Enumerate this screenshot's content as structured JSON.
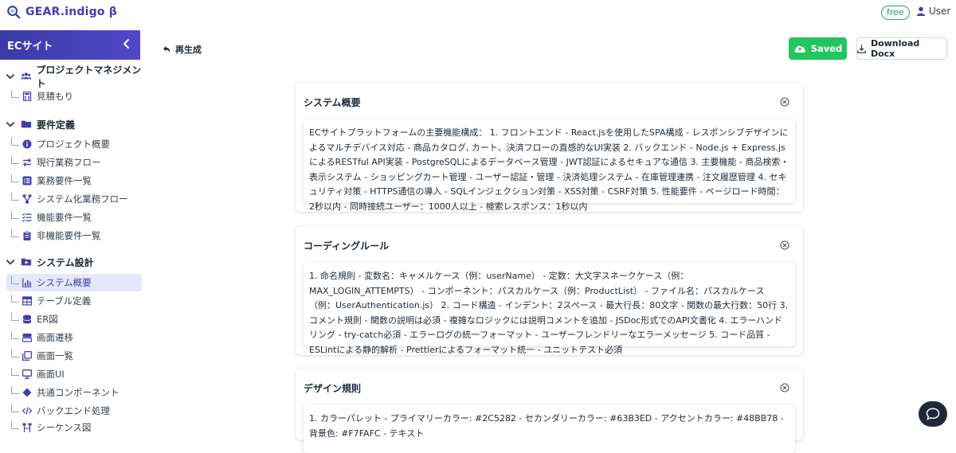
{
  "app": {
    "brand": "GEAR.indigo β",
    "plan_badge": "free",
    "user_label": "User"
  },
  "sidebar": {
    "project_name": "ECサイト",
    "sections": [
      {
        "label": "プロジェクトマネジメント",
        "icon": "users-icon",
        "items": [
          {
            "label": "見積もり",
            "icon": "calculator-icon"
          }
        ]
      },
      {
        "label": "要件定義",
        "icon": "folder-icon",
        "items": [
          {
            "label": "プロジェクト概要",
            "icon": "info-icon"
          },
          {
            "label": "現行業務フロー",
            "icon": "swap-icon"
          },
          {
            "label": "業務要件一覧",
            "icon": "list-icon"
          },
          {
            "label": "システム化業務フロー",
            "icon": "flow-icon"
          },
          {
            "label": "機能要件一覧",
            "icon": "checklist-icon"
          },
          {
            "label": "非機能要件一覧",
            "icon": "clipboard-icon"
          }
        ]
      },
      {
        "label": "システム設計",
        "icon": "folder-plus-icon",
        "items": [
          {
            "label": "システム概要",
            "icon": "bar-chart-icon",
            "active": true
          },
          {
            "label": "テーブル定義",
            "icon": "table-icon"
          },
          {
            "label": "ER図",
            "icon": "database-icon"
          },
          {
            "label": "画面遷移",
            "icon": "screens-icon"
          },
          {
            "label": "画面一覧",
            "icon": "copy-icon"
          },
          {
            "label": "画面UI",
            "icon": "monitor-icon"
          },
          {
            "label": "共通コンポーネント",
            "icon": "diamond-icon"
          },
          {
            "label": "バックエンド処理",
            "icon": "code-icon"
          },
          {
            "label": "シーケンス図",
            "icon": "sequence-icon"
          }
        ]
      }
    ]
  },
  "toolbar": {
    "regenerate_label": "再生成",
    "saved_label": "Saved",
    "download_label": "Download Docx"
  },
  "cards": [
    {
      "title": "システム概要",
      "body": "ECサイトプラットフォームの主要機能構成： 1. フロントエンド - React.jsを使用したSPA構成 - レスポンシブデザインによるマルチデバイス対応 - 商品カタログ, カート、決済フローの直感的なUI実装 2. バックエンド - Node.js + Express.jsによるRESTful API実装 - PostgreSQLによるデータベース管理 - JWT認証によるセキュアな通信 3. 主要機能 - 商品検索・表示システム - ショッピングカート管理 - ユーザー認証・管理 - 決済処理システム - 在庫管理連携 - 注文履歴管理 4. セキュリティ対策 - HTTPS通信の導入 - SQLインジェクション対策 - XSS対策 - CSRF対策 5. 性能要件 - ページロード時間：2秒以内 - 同時接続ユーザー：1000人以上 - 検索レスポンス：1秒以内"
    },
    {
      "title": "コーディングルール",
      "body": "1. 命名規則 - 変数名：キャメルケース（例：userName） - 定数：大文字スネークケース（例：MAX_LOGIN_ATTEMPTS） - コンポーネント：パスカルケース（例：ProductList） - ファイル名：パスカルケース（例：UserAuthentication.js） 2. コード構造 - インデント：2スペース - 最大行長：80文字 - 関数の最大行数：50行 3. コメント規則 - 関数の説明は必須 - 複雑なロジックには説明コメントを追加 - JSDoc形式でのAPI文書化 4. エラーハンドリング - try-catch必須 - エラーログの統一フォーマット - ユーザーフレンドリーなエラーメッセージ 5. コード品質 - ESLintによる静的解析 - Prettierによるフォーマット統一 - ユニットテスト必須"
    },
    {
      "title": "デザイン規則",
      "body": "1. カラーパレット - プライマリーカラー: #2C5282 - セカンダリーカラー: #63B3ED - アクセントカラー: #48BB78 - 背景色: #F7FAFC - テキスト"
    }
  ],
  "colors": {
    "brand": "#3f3fb0",
    "saved_green": "#22c55e",
    "free_badge_green": "#22a55b",
    "active_item_bg": "#e4e8fb"
  }
}
